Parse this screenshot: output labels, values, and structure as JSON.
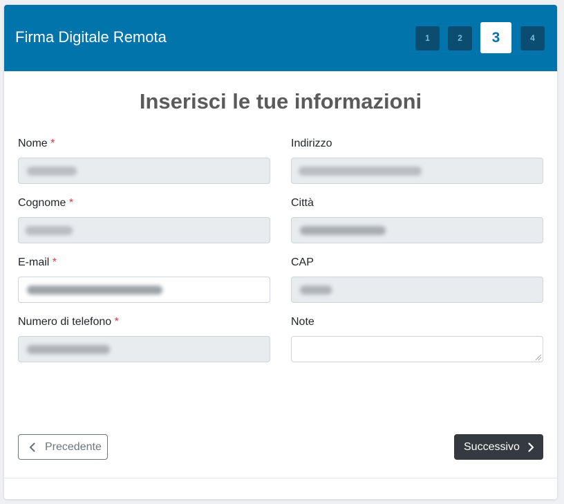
{
  "header": {
    "title": "Firma Digitale Remota",
    "steps": [
      {
        "label": "1",
        "active": false
      },
      {
        "label": "2",
        "active": false
      },
      {
        "label": "3",
        "active": true
      },
      {
        "label": "4",
        "active": false
      }
    ]
  },
  "form": {
    "title": "Inserisci le tue informazioni",
    "required_marker": "*",
    "fields": {
      "nome": {
        "label": "Nome",
        "required": true,
        "value": "",
        "readonly": true
      },
      "cognome": {
        "label": "Cognome",
        "required": true,
        "value": "",
        "readonly": true
      },
      "email": {
        "label": "E-mail",
        "required": true,
        "value": "",
        "readonly": false
      },
      "telefono": {
        "label": "Numero di telefono",
        "required": true,
        "value": "",
        "readonly": true
      },
      "indirizzo": {
        "label": "Indirizzo",
        "required": false,
        "value": "",
        "readonly": true
      },
      "citta": {
        "label": "Città",
        "required": false,
        "value": "",
        "readonly": true
      },
      "cap": {
        "label": "CAP",
        "required": false,
        "value": "",
        "readonly": true
      },
      "note": {
        "label": "Note",
        "required": false,
        "value": "",
        "readonly": false
      }
    }
  },
  "nav": {
    "prev_label": "Precedente",
    "next_label": "Successivo"
  },
  "colors": {
    "header_bg": "#0074ab",
    "step_inactive_bg": "#0a4d70",
    "required": "#dc3545",
    "next_button_bg": "#343a40"
  },
  "icons": {
    "prev": "chevron-left-icon",
    "next": "chevron-right-icon"
  }
}
